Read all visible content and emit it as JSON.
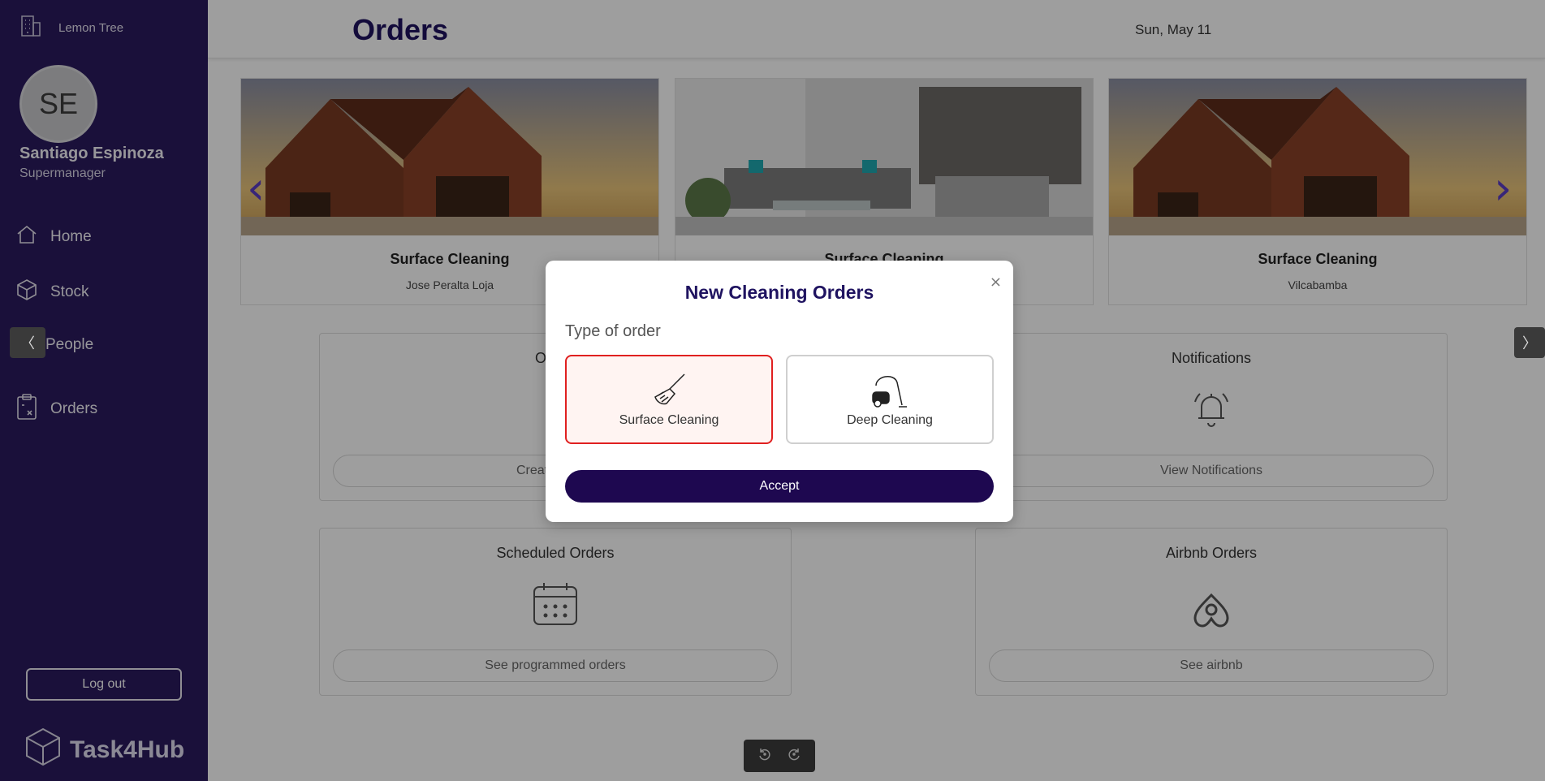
{
  "sidebar": {
    "org_name": "Lemon Tree",
    "avatar_initials": "SE",
    "user_name": "Santiago Espinoza",
    "user_role": "Supermanager",
    "nav": [
      {
        "label": "Home",
        "icon": "home-icon"
      },
      {
        "label": "Stock",
        "icon": "box-icon"
      },
      {
        "label": "People",
        "icon": "people-icon"
      },
      {
        "label": "Orders",
        "icon": "clipboard-icon"
      }
    ],
    "logout_label": "Log out",
    "brand": "Task4Hub",
    "colors": {
      "background": "#2a1a5e"
    }
  },
  "header": {
    "title": "Orders",
    "date": "Sun, May 11"
  },
  "carousel": [
    {
      "title": "Surface Cleaning",
      "subtitle": "Jose Peralta Loja",
      "image": "cabin-house"
    },
    {
      "title": "Surface Cleaning",
      "subtitle": "",
      "image": "living-room"
    },
    {
      "title": "Surface Cleaning",
      "subtitle": "Vilcabamba",
      "image": "cabin-house"
    }
  ],
  "panels": {
    "orders": {
      "title": "Orders",
      "button": "Create"
    },
    "notifications": {
      "title": "Notifications",
      "button": "View Notifications",
      "icon": "bell-icon"
    },
    "scheduled": {
      "title": "Scheduled Orders",
      "button": "See programmed orders",
      "icon": "calendar-icon"
    },
    "airbnb": {
      "title": "Airbnb Orders",
      "button": "See airbnb",
      "icon": "airbnb-icon"
    }
  },
  "modal": {
    "title": "New Cleaning Orders",
    "close": "×",
    "type_label": "Type of order",
    "options": [
      {
        "label": "Surface Cleaning",
        "icon": "broom-icon",
        "selected": true
      },
      {
        "label": "Deep Cleaning",
        "icon": "vacuum-icon",
        "selected": false
      }
    ],
    "accept_label": "Accept",
    "colors": {
      "accept": "#1e0850",
      "selected_border": "#e02020",
      "title": "#1f1360"
    }
  },
  "toggles": {
    "left": "〈",
    "right": "〉"
  }
}
